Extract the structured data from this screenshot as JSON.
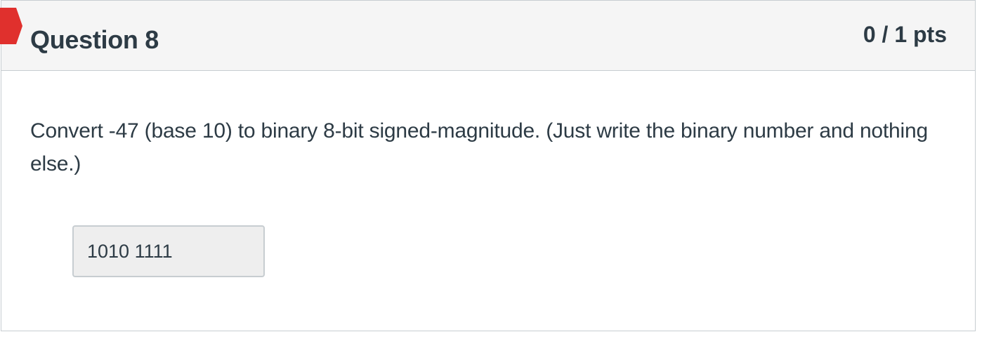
{
  "question": {
    "title": "Question 8",
    "points": "0 / 1 pts",
    "status_flag": "incorrect-flag",
    "text": "Convert -47 (base 10) to binary 8-bit signed-magnitude. (Just write the binary number and nothing else.)",
    "answer": "1010 1111"
  },
  "colors": {
    "flag": "#e0302d",
    "header_bg": "#f5f5f5",
    "border": "#c7cdd1",
    "text": "#2d3b45",
    "answer_bg": "#eeeeee"
  }
}
